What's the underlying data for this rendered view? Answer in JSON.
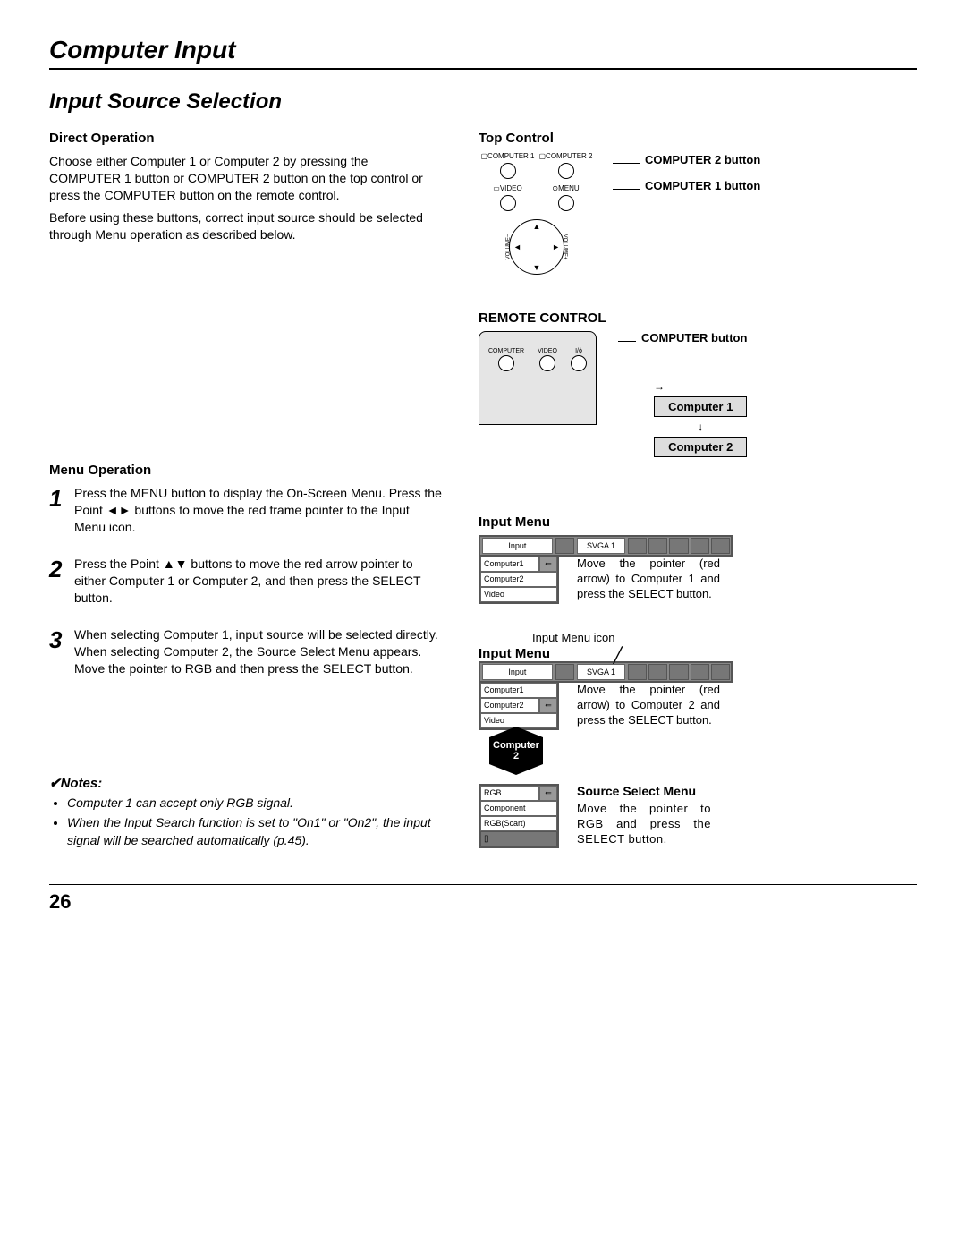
{
  "pageTitle": "Computer Input",
  "sectionTitle": "Input Source Selection",
  "pageNumber": "26",
  "left": {
    "directOp": {
      "heading": "Direct Operation",
      "p1": "Choose either Computer 1 or Computer 2 by pressing the COMPUTER 1 button or COMPUTER 2 button on the top control or press the COMPUTER button on the remote control.",
      "p2": "Before using these buttons, correct input source should be selected through Menu operation as described below."
    },
    "menuOp": {
      "heading": "Menu Operation",
      "step1": "Press the MENU button to display the On-Screen Menu.  Press the Point ◄► buttons to move the red frame pointer to the Input Menu icon.",
      "step2": "Press the Point ▲▼ buttons to move the red arrow pointer to either Computer 1 or Computer 2, and then press the SELECT button.",
      "step3a": "When selecting Computer 1, input source will be selected directly.",
      "step3b": "When selecting Computer 2, the Source Select Menu appears. Move the pointer to RGB and then press the SELECT button."
    }
  },
  "notes": {
    "heading": "✔Notes:",
    "items": [
      "Computer 1 can accept only RGB signal.",
      "When the Input Search function is set to \"On1\" or \"On2\", the input signal will be searched automatically (p.45)."
    ]
  },
  "right": {
    "topControl": {
      "heading": "Top Control",
      "labels": {
        "c1": "COMPUTER 1",
        "c2": "COMPUTER 2",
        "video": "VIDEO",
        "menu": "MENU",
        "volDn": "VOLUME−",
        "volUp": "VOLUME+"
      },
      "callout2": "COMPUTER 2 button",
      "callout1": "COMPUTER 1 button"
    },
    "remote": {
      "heading": "REMOTE CONTROL",
      "btnLabels": {
        "computer": "COMPUTER",
        "video": "VIDEO",
        "power": "I/ϕ"
      },
      "computerBtn": "COMPUTER button",
      "comp1": "Computer 1",
      "comp2": "Computer 2"
    },
    "inputMenu1": {
      "heading": "Input Menu",
      "tab": "Input",
      "svga": "SVGA 1",
      "items": [
        "Computer1",
        "Computer2",
        "Video"
      ],
      "desc": "Move the pointer (red arrow) to Computer 1 and press the SELECT button."
    },
    "inputMenu2": {
      "iconLabel": "Input Menu icon",
      "heading": "Input Menu",
      "tab": "Input",
      "svga": "SVGA 1",
      "items": [
        "Computer1",
        "Computer2",
        "Video"
      ],
      "desc": "Move the pointer (red arrow) to Computer 2 and press the SELECT button.",
      "badge": "Computer 2"
    },
    "sourceSelect": {
      "heading": "Source Select Menu",
      "items": [
        "RGB",
        "Component",
        "RGB(Scart)"
      ],
      "desc": "Move the pointer to RGB and press the SELECT button."
    }
  }
}
